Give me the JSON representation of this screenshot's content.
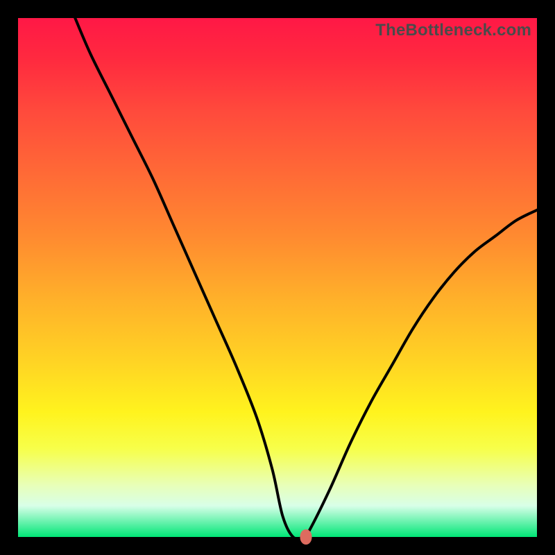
{
  "watermark": "TheBottleneck.com",
  "gradient_colors": {
    "top": "#ff1846",
    "mid_upper": "#ff6a36",
    "mid": "#ffd324",
    "mid_lower": "#fff31e",
    "bottom": "#00e676"
  },
  "curve_color": "#000000",
  "dot_color": "#dd6b5f",
  "chart_data": {
    "type": "line",
    "title": "",
    "xlabel": "",
    "ylabel": "",
    "xlim": [
      0,
      100
    ],
    "ylim": [
      0,
      100
    ],
    "series": [
      {
        "name": "bottleneck-curve",
        "x": [
          11,
          14,
          18,
          22,
          26,
          30,
          34,
          38,
          42,
          46,
          49,
          51,
          53,
          55,
          56,
          60,
          64,
          68,
          72,
          76,
          80,
          84,
          88,
          92,
          96,
          100
        ],
        "y": [
          100,
          93,
          85,
          77,
          69,
          60,
          51,
          42,
          33,
          23,
          13,
          4,
          0,
          0,
          1,
          9,
          18,
          26,
          33,
          40,
          46,
          51,
          55,
          58,
          61,
          63
        ]
      }
    ],
    "marker": {
      "x": 55.5,
      "y": 0
    },
    "grid": false,
    "legend_position": "none"
  }
}
